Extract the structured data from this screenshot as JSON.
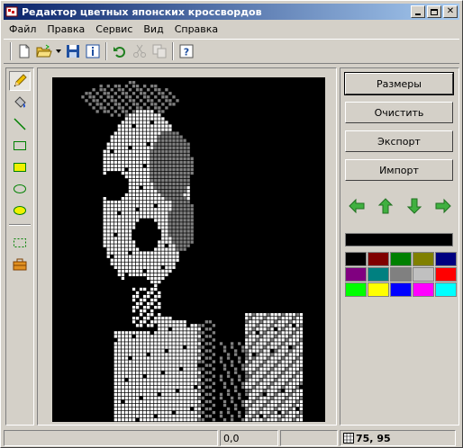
{
  "window": {
    "title": "Редактор цветных японских кроссвордов"
  },
  "menu": [
    "Файл",
    "Правка",
    "Сервис",
    "Вид",
    "Справка"
  ],
  "toolbar": [
    {
      "name": "new-file-icon",
      "enabled": true
    },
    {
      "name": "open-folder-icon",
      "enabled": true
    },
    {
      "name": "dropdown-arrow-icon",
      "enabled": true
    },
    {
      "name": "save-icon",
      "enabled": true
    },
    {
      "name": "info-icon",
      "enabled": true
    },
    {
      "name": "undo-icon",
      "enabled": true
    },
    {
      "name": "cut-icon",
      "enabled": false
    },
    {
      "name": "copy-icon",
      "enabled": false
    },
    {
      "name": "help-icon",
      "enabled": true
    }
  ],
  "tools": [
    {
      "name": "pencil-icon",
      "active": true
    },
    {
      "name": "fill-bucket-icon",
      "active": false
    },
    {
      "name": "line-icon",
      "active": false
    },
    {
      "name": "rectangle-icon",
      "active": false
    },
    {
      "name": "filled-rectangle-icon",
      "active": false
    },
    {
      "name": "ellipse-icon",
      "active": false
    },
    {
      "name": "filled-ellipse-icon",
      "active": false
    },
    {
      "name": "selection-icon",
      "active": false
    },
    {
      "name": "toolbox-icon",
      "active": false
    }
  ],
  "panel": {
    "sizes": "Размеры",
    "clear": "Очистить",
    "export": "Экспорт",
    "import": "Импорт"
  },
  "current_color": "#000000",
  "palette": [
    "#000000",
    "#800000",
    "#008000",
    "#808000",
    "#000080",
    "#800080",
    "#008080",
    "#808080",
    "#c0c0c0",
    "#ff0000",
    "#00ff00",
    "#ffff00",
    "#0000ff",
    "#ff00ff",
    "#00ffff"
  ],
  "grid": {
    "columns": 75,
    "rows": 95,
    "background": "#000000"
  },
  "status": {
    "cursor": "0,0",
    "size": "75, 95"
  }
}
